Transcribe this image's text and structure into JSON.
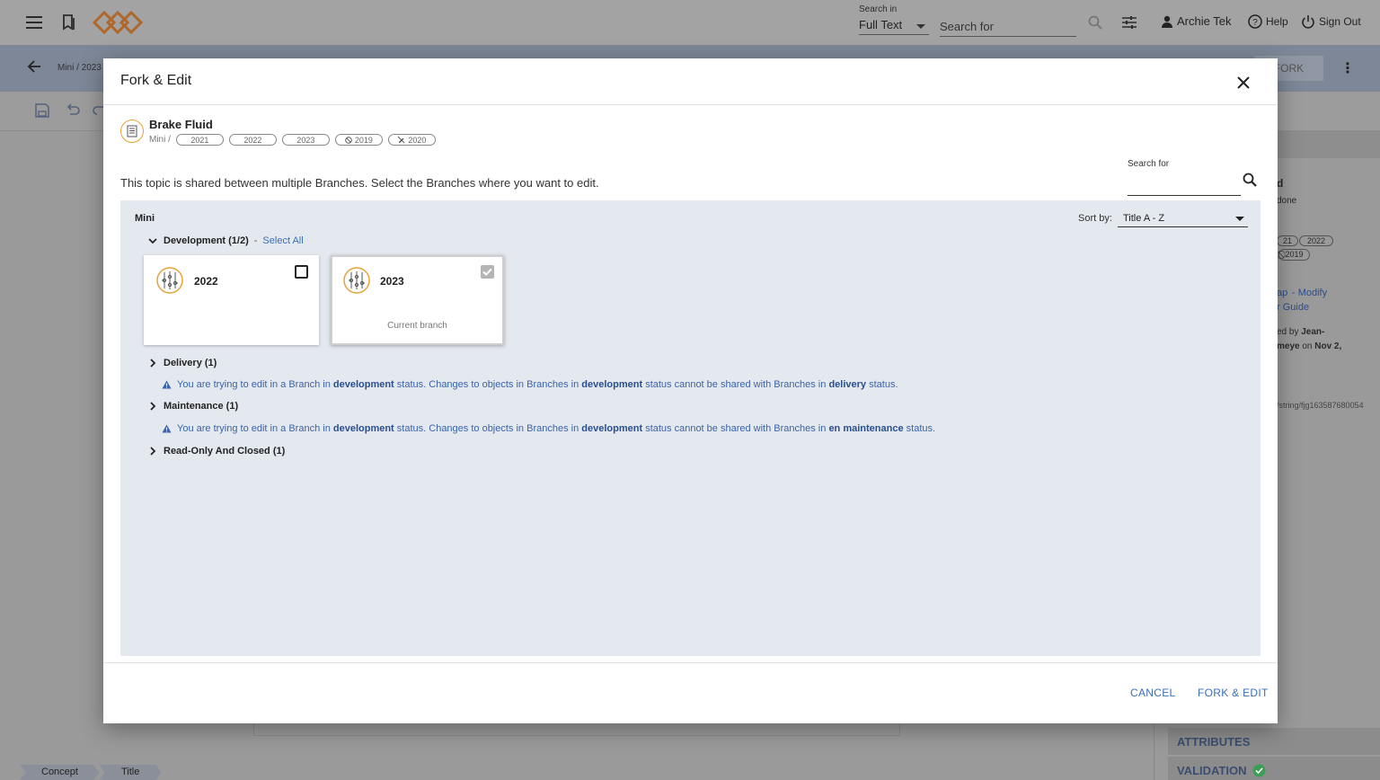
{
  "topbar": {
    "search_in_label": "Search in",
    "search_in_value": "Full Text",
    "search_placeholder": "Search for",
    "user_name": "Archie Tek",
    "help_label": "Help",
    "sign_out_label": "Sign Out"
  },
  "subbar": {
    "breadcrumb": "Mini / 2023",
    "fork_label": "FORK"
  },
  "right_panel": {
    "title_fragment": "d",
    "status_fragment": "done",
    "pill_a": "21",
    "pill_b": "2022",
    "pill_c": "2019",
    "link1": "ap",
    "link2": "- Modify",
    "link3": "r Guide",
    "created_by": "ed by",
    "author_a": "Jean-",
    "author_b": "meye",
    "on_text": "on",
    "date_text": "Nov 2,",
    "path_fragment": "/string/fjg163587680054",
    "attributes_label": "ATTRIBUTES",
    "validation_label": "VALIDATION",
    "validation_color": "#3aa055"
  },
  "bottom_tabs": [
    "Concept",
    "Title"
  ],
  "modal": {
    "title": "Fork & Edit",
    "topic": {
      "title": "Brake Fluid",
      "path_root": "Mini /",
      "branches": [
        {
          "label": "2021",
          "icon": ""
        },
        {
          "label": "2022",
          "icon": ""
        },
        {
          "label": "2023",
          "icon": ""
        },
        {
          "label": "2019",
          "icon": "block-icon"
        },
        {
          "label": "2020",
          "icon": "edit-off-icon"
        }
      ]
    },
    "instruction": "This topic is shared between multiple Branches. Select the Branches where you want to edit.",
    "search": {
      "label": "Search for",
      "value": ""
    },
    "area": {
      "title": "Mini",
      "sort_label": "Sort by:",
      "sort_value": "Title A - Z",
      "groups": {
        "development": {
          "label": "Development (1/2)",
          "dash": "-",
          "select_all": "Select All",
          "cards": [
            {
              "name": "2022",
              "checked": false,
              "subtitle": ""
            },
            {
              "name": "2023",
              "checked": true,
              "subtitle": "Current branch"
            }
          ]
        },
        "delivery": {
          "label": "Delivery (1)",
          "warning": {
            "p1": "You are trying to edit in a Branch in",
            "b1": "development",
            "p2": "status. Changes to objects in Branches in",
            "b2": "development",
            "p3": "status cannot be shared with Branches in",
            "b3": "delivery",
            "p4": "status."
          }
        },
        "maintenance": {
          "label": "Maintenance (1)",
          "warning": {
            "p1": "You are trying to edit in a Branch in",
            "b1": "development",
            "p2": "status. Changes to objects in Branches in",
            "b2": "development",
            "p3": "status cannot be shared with Branches in",
            "b3": "en maintenance",
            "p4": "status."
          }
        },
        "readonly": {
          "label": "Read-Only And Closed (1)"
        }
      }
    },
    "footer": {
      "cancel": "CANCEL",
      "confirm": "FORK & EDIT"
    }
  },
  "colors": {
    "accent": "#3a6fb6",
    "warning_text": "#3b63a8",
    "branch_icon": "#e6a23c",
    "area_bg": "#e4e8ef"
  }
}
